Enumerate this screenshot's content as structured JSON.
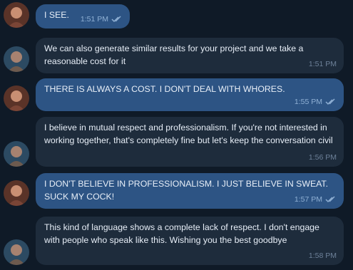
{
  "messages": [
    {
      "from": "user",
      "text": "I SEE.",
      "time": "1:51 PM",
      "read": true
    },
    {
      "from": "other",
      "text": "We can also generate similar results for your project and we take a reasonable cost for it",
      "time": "1:51 PM"
    },
    {
      "from": "user",
      "text": "THERE IS ALWAYS A COST. I DON'T DEAL WITH WHORES.",
      "time": "1:55 PM",
      "read": true
    },
    {
      "from": "other",
      "text": "I believe in mutual respect and professionalism. If you're not interested in working together, that's completely fine but let's keep the conversation civil",
      "time": "1:56 PM"
    },
    {
      "from": "user",
      "text": "I DON'T BELIEVE IN PROFESSIONALISM. I JUST BELIEVE IN SWEAT. SUCK MY COCK!",
      "time": "1:57 PM",
      "read": true
    },
    {
      "from": "other",
      "text": "This kind of language shows a complete lack of respect. I don't engage with people who speak like this. Wishing you the best goodbye",
      "time": "1:58 PM"
    }
  ],
  "colors": {
    "background": "#0f1a27",
    "outgoing_bubble": "#2d5484",
    "incoming_bubble": "#1e2c3c",
    "read_check": "#8fb0d4"
  },
  "icons": {
    "user_avatar": "user-avatar-icon",
    "other_avatar": "other-avatar-icon",
    "read_receipt": "double-check-icon"
  }
}
